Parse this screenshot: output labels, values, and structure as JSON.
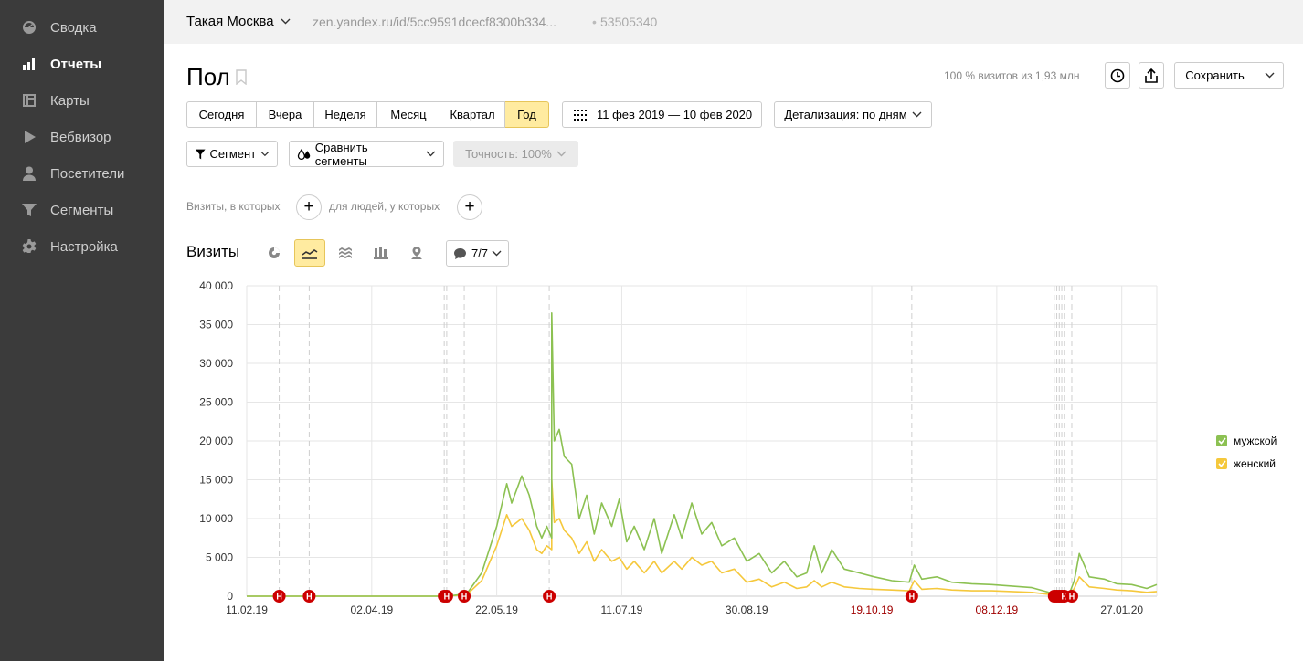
{
  "sidebar": {
    "items": [
      {
        "label": "Сводка",
        "icon": "gauge-icon",
        "active": false
      },
      {
        "label": "Отчеты",
        "icon": "bar-chart-icon",
        "active": true
      },
      {
        "label": "Карты",
        "icon": "map-layout-icon",
        "active": false
      },
      {
        "label": "Вебвизор",
        "icon": "play-icon",
        "active": false
      },
      {
        "label": "Посетители",
        "icon": "user-icon",
        "active": false
      },
      {
        "label": "Сегменты",
        "icon": "filter-icon",
        "active": false
      },
      {
        "label": "Настройка",
        "icon": "gear-icon",
        "active": false
      }
    ]
  },
  "topbar": {
    "site_name": "Такая Москва",
    "site_url": "zen.yandex.ru/id/5cc9591dcecf8300b334...",
    "separator": "•",
    "counter_id": "53505340"
  },
  "header": {
    "title": "Пол",
    "visits_share": "100 % визитов из 1,93 млн",
    "save_label": "Сохранить"
  },
  "period": {
    "buttons": [
      "Сегодня",
      "Вчера",
      "Неделя",
      "Месяц",
      "Квартал",
      "Год"
    ],
    "selected": "Год",
    "date_range": "11 фев 2019 — 10 фев 2020",
    "detail": "Детализация: по дням"
  },
  "segments": {
    "segment_label": "Сегмент",
    "compare_label": "Сравнить сегменты",
    "accuracy_label": "Точность: 100%"
  },
  "conditions": {
    "visits_label": "Визиты, в которых",
    "people_label": "для людей, у которых",
    "plus": "+"
  },
  "chart_controls": {
    "title": "Визиты",
    "annotations_label": "7/7"
  },
  "colors": {
    "male": "#8cc152",
    "female": "#f5c83c",
    "annotation": "#cc0000",
    "selected_bg": "#ffeba0",
    "sidebar_bg": "#3b3b3b"
  },
  "annotation_marker": "Н",
  "chart_data": {
    "type": "line",
    "title": "",
    "xlabel": "",
    "ylabel": "",
    "ylim": [
      0,
      40000
    ],
    "yticks": [
      "40 000",
      "35 000",
      "30 000",
      "25 000",
      "20 000",
      "15 000",
      "10 000",
      "5 000",
      "0"
    ],
    "ytick_values": [
      40000,
      35000,
      30000,
      25000,
      20000,
      15000,
      10000,
      5000,
      0
    ],
    "x_range": [
      "2019-02-11",
      "2020-02-10"
    ],
    "xticks": [
      {
        "label": "11.02.19",
        "date": "2019-02-11",
        "holiday": false
      },
      {
        "label": "02.04.19",
        "date": "2019-04-02",
        "holiday": false
      },
      {
        "label": "22.05.19",
        "date": "2019-05-22",
        "holiday": false
      },
      {
        "label": "11.07.19",
        "date": "2019-07-11",
        "holiday": false
      },
      {
        "label": "30.08.19",
        "date": "2019-08-30",
        "holiday": false
      },
      {
        "label": "19.10.19",
        "date": "2019-10-19",
        "holiday": true
      },
      {
        "label": "08.12.19",
        "date": "2019-12-08",
        "holiday": true
      },
      {
        "label": "27.01.20",
        "date": "2020-01-27",
        "holiday": false
      }
    ],
    "annotations": [
      "2019-02-24",
      "2019-03-08",
      "2019-05-01",
      "2019-05-02",
      "2019-05-09",
      "2019-06-12",
      "2019-11-04",
      "2019-12-31",
      "2020-01-01",
      "2020-01-02",
      "2020-01-03",
      "2020-01-04",
      "2020-01-07"
    ],
    "legend": "right",
    "series": [
      {
        "name": "мужской",
        "points": [
          [
            "2019-02-11",
            0
          ],
          [
            "2019-05-02",
            0
          ],
          [
            "2019-05-10",
            300
          ],
          [
            "2019-05-16",
            3000
          ],
          [
            "2019-05-22",
            9000
          ],
          [
            "2019-05-26",
            14500
          ],
          [
            "2019-05-28",
            12000
          ],
          [
            "2019-06-01",
            15500
          ],
          [
            "2019-06-04",
            13000
          ],
          [
            "2019-06-07",
            9000
          ],
          [
            "2019-06-09",
            7500
          ],
          [
            "2019-06-11",
            9000
          ],
          [
            "2019-06-13",
            7500
          ],
          [
            "2019-06-13",
            36500
          ],
          [
            "2019-06-14",
            20000
          ],
          [
            "2019-06-16",
            21500
          ],
          [
            "2019-06-18",
            18000
          ],
          [
            "2019-06-21",
            17000
          ],
          [
            "2019-06-24",
            10000
          ],
          [
            "2019-06-27",
            13000
          ],
          [
            "2019-06-30",
            8000
          ],
          [
            "2019-07-03",
            12000
          ],
          [
            "2019-07-07",
            9000
          ],
          [
            "2019-07-10",
            12500
          ],
          [
            "2019-07-13",
            7000
          ],
          [
            "2019-07-16",
            9000
          ],
          [
            "2019-07-20",
            6000
          ],
          [
            "2019-07-24",
            10000
          ],
          [
            "2019-07-27",
            5500
          ],
          [
            "2019-08-01",
            10500
          ],
          [
            "2019-08-04",
            7500
          ],
          [
            "2019-08-08",
            12000
          ],
          [
            "2019-08-12",
            8000
          ],
          [
            "2019-08-16",
            9500
          ],
          [
            "2019-08-20",
            6500
          ],
          [
            "2019-08-25",
            7500
          ],
          [
            "2019-08-30",
            4500
          ],
          [
            "2019-09-04",
            5500
          ],
          [
            "2019-09-09",
            3000
          ],
          [
            "2019-09-14",
            4500
          ],
          [
            "2019-09-19",
            2500
          ],
          [
            "2019-09-23",
            3000
          ],
          [
            "2019-09-26",
            6500
          ],
          [
            "2019-09-29",
            3000
          ],
          [
            "2019-10-03",
            6000
          ],
          [
            "2019-10-08",
            3500
          ],
          [
            "2019-10-14",
            3000
          ],
          [
            "2019-10-20",
            2500
          ],
          [
            "2019-10-27",
            2000
          ],
          [
            "2019-11-03",
            1800
          ],
          [
            "2019-11-05",
            4000
          ],
          [
            "2019-11-08",
            2200
          ],
          [
            "2019-11-14",
            2500
          ],
          [
            "2019-11-20",
            1800
          ],
          [
            "2019-11-28",
            1600
          ],
          [
            "2019-12-06",
            1500
          ],
          [
            "2019-12-14",
            1300
          ],
          [
            "2019-12-22",
            1100
          ],
          [
            "2019-12-31",
            300
          ],
          [
            "2020-01-06",
            300
          ],
          [
            "2020-01-08",
            2000
          ],
          [
            "2020-01-10",
            5500
          ],
          [
            "2020-01-14",
            2500
          ],
          [
            "2020-01-20",
            2200
          ],
          [
            "2020-01-25",
            1600
          ],
          [
            "2020-01-31",
            1500
          ],
          [
            "2020-02-06",
            1000
          ],
          [
            "2020-02-10",
            1500
          ]
        ]
      },
      {
        "name": "женский",
        "points": [
          [
            "2019-02-11",
            0
          ],
          [
            "2019-05-02",
            0
          ],
          [
            "2019-05-10",
            200
          ],
          [
            "2019-05-16",
            2000
          ],
          [
            "2019-05-22",
            6500
          ],
          [
            "2019-05-26",
            10500
          ],
          [
            "2019-05-28",
            9000
          ],
          [
            "2019-06-01",
            10000
          ],
          [
            "2019-06-04",
            8500
          ],
          [
            "2019-06-07",
            6000
          ],
          [
            "2019-06-09",
            5500
          ],
          [
            "2019-06-11",
            6500
          ],
          [
            "2019-06-13",
            6000
          ],
          [
            "2019-06-13",
            15000
          ],
          [
            "2019-06-14",
            9500
          ],
          [
            "2019-06-16",
            10000
          ],
          [
            "2019-06-18",
            8500
          ],
          [
            "2019-06-21",
            7500
          ],
          [
            "2019-06-24",
            5500
          ],
          [
            "2019-06-27",
            7000
          ],
          [
            "2019-06-30",
            4500
          ],
          [
            "2019-07-03",
            6000
          ],
          [
            "2019-07-07",
            4500
          ],
          [
            "2019-07-10",
            5000
          ],
          [
            "2019-07-13",
            3500
          ],
          [
            "2019-07-16",
            4500
          ],
          [
            "2019-07-20",
            3000
          ],
          [
            "2019-07-24",
            4500
          ],
          [
            "2019-07-27",
            3000
          ],
          [
            "2019-08-01",
            4500
          ],
          [
            "2019-08-04",
            3500
          ],
          [
            "2019-08-08",
            5000
          ],
          [
            "2019-08-12",
            4000
          ],
          [
            "2019-08-16",
            4500
          ],
          [
            "2019-08-20",
            3000
          ],
          [
            "2019-08-25",
            3500
          ],
          [
            "2019-08-30",
            1800
          ],
          [
            "2019-09-04",
            2200
          ],
          [
            "2019-09-09",
            1200
          ],
          [
            "2019-09-14",
            1800
          ],
          [
            "2019-09-19",
            1000
          ],
          [
            "2019-09-23",
            1200
          ],
          [
            "2019-09-26",
            2000
          ],
          [
            "2019-09-29",
            1200
          ],
          [
            "2019-10-03",
            1800
          ],
          [
            "2019-10-08",
            1200
          ],
          [
            "2019-10-14",
            1000
          ],
          [
            "2019-10-20",
            900
          ],
          [
            "2019-10-27",
            800
          ],
          [
            "2019-11-03",
            700
          ],
          [
            "2019-11-05",
            2000
          ],
          [
            "2019-11-08",
            900
          ],
          [
            "2019-11-14",
            1000
          ],
          [
            "2019-11-20",
            800
          ],
          [
            "2019-11-28",
            700
          ],
          [
            "2019-12-06",
            700
          ],
          [
            "2019-12-14",
            600
          ],
          [
            "2019-12-22",
            500
          ],
          [
            "2019-12-31",
            150
          ],
          [
            "2020-01-06",
            150
          ],
          [
            "2020-01-08",
            1000
          ],
          [
            "2020-01-10",
            2500
          ],
          [
            "2020-01-14",
            1200
          ],
          [
            "2020-01-20",
            1000
          ],
          [
            "2020-01-25",
            800
          ],
          [
            "2020-01-31",
            700
          ],
          [
            "2020-02-06",
            500
          ],
          [
            "2020-02-10",
            600
          ]
        ]
      }
    ]
  }
}
